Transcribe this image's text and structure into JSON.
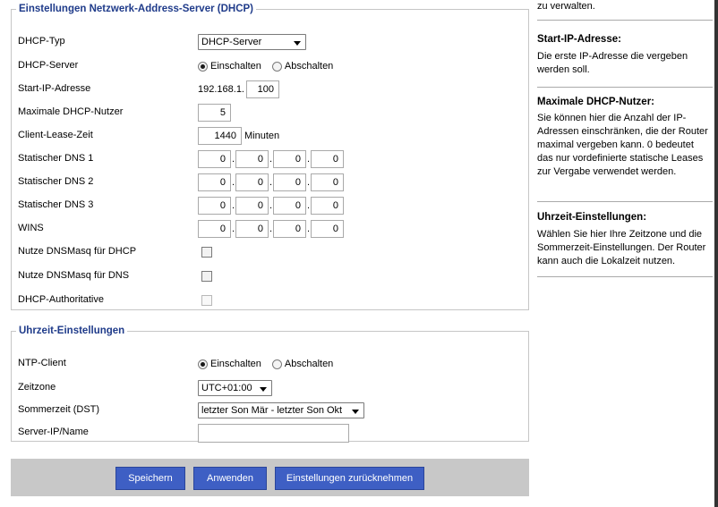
{
  "dhcp": {
    "legend": "Einstellungen Netzwerk-Address-Server (DHCP)",
    "type_label": "DHCP-Typ",
    "type_value": "DHCP-Server",
    "server_label": "DHCP-Server",
    "radio_on": "Einschalten",
    "radio_off": "Abschalten",
    "start_ip_label": "Start-IP-Adresse",
    "start_ip_prefix": "192.168.1.",
    "start_ip_last": "100",
    "max_users_label": "Maximale DHCP-Nutzer",
    "max_users_value": "5",
    "lease_label": "Client-Lease-Zeit",
    "lease_value": "1440",
    "lease_unit": "Minuten",
    "dns1_label": "Statischer DNS 1",
    "dns2_label": "Statischer DNS 2",
    "dns3_label": "Statischer DNS 3",
    "wins_label": "WINS",
    "ip_octet": "0",
    "dot": ".",
    "dnsmasq_dhcp_label": "Nutze DNSMasq für DHCP",
    "dnsmasq_dns_label": "Nutze DNSMasq für DNS",
    "authoritative_label": "DHCP-Authoritative"
  },
  "time": {
    "legend": "Uhrzeit-Einstellungen",
    "ntp_label": "NTP-Client",
    "radio_on": "Einschalten",
    "radio_off": "Abschalten",
    "zone_label": "Zeitzone",
    "zone_value": "UTC+01:00",
    "dst_label": "Sommerzeit (DST)",
    "dst_value": "letzter Son Mär - letzter Son Okt",
    "server_label": "Server-IP/Name",
    "server_value": ""
  },
  "buttons": {
    "save": "Speichern",
    "apply": "Anwenden",
    "reset": "Einstellungen zurücknehmen"
  },
  "help": {
    "top_text": "zu verwalten.",
    "start_ip_title": "Start-IP-Adresse:",
    "start_ip_text": "Die erste IP-Adresse die vergeben werden soll.",
    "max_users_title": "Maximale DHCP-Nutzer:",
    "max_users_text": "Sie können hier die Anzahl der IP-Adressen einschränken, die der Router maximal vergeben kann. 0 bedeutet das nur vordefinierte statische Leases zur Vergabe verwendet werden.",
    "time_title": "Uhrzeit-Einstellungen:",
    "time_text": "Wählen Sie hier Ihre Zeitzone und die Sommerzeit-Einstellungen. Der Router kann auch die Lokalzeit nutzen."
  }
}
